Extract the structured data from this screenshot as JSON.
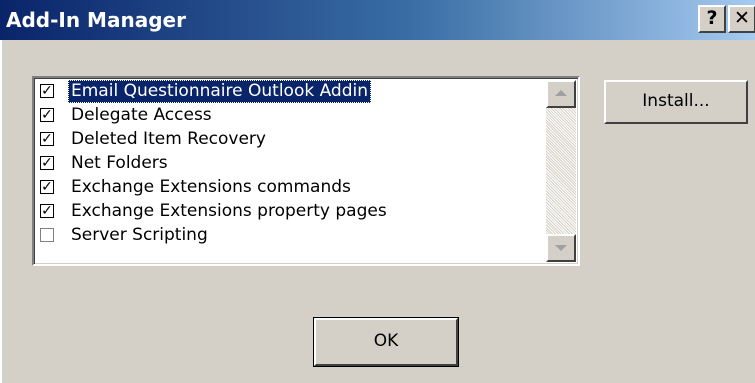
{
  "window": {
    "title": "Add-In Manager",
    "help_label": "?",
    "close_label": "✕"
  },
  "addins": {
    "items": [
      {
        "label": "Email Questionnaire Outlook Addin",
        "checked": true,
        "selected": true
      },
      {
        "label": "Delegate Access",
        "checked": true,
        "selected": false
      },
      {
        "label": "Deleted Item Recovery",
        "checked": true,
        "selected": false
      },
      {
        "label": "Net Folders",
        "checked": true,
        "selected": false
      },
      {
        "label": "Exchange Extensions commands",
        "checked": true,
        "selected": false
      },
      {
        "label": "Exchange Extensions property pages",
        "checked": true,
        "selected": false
      },
      {
        "label": "Server Scripting",
        "checked": false,
        "selected": false
      }
    ]
  },
  "buttons": {
    "install_label": "Install...",
    "ok_label": "OK"
  },
  "colors": {
    "titlebar_start": "#0a246a",
    "titlebar_end": "#a6caf0",
    "dialog_face": "#d4d0c8",
    "selection": "#0a246a"
  }
}
